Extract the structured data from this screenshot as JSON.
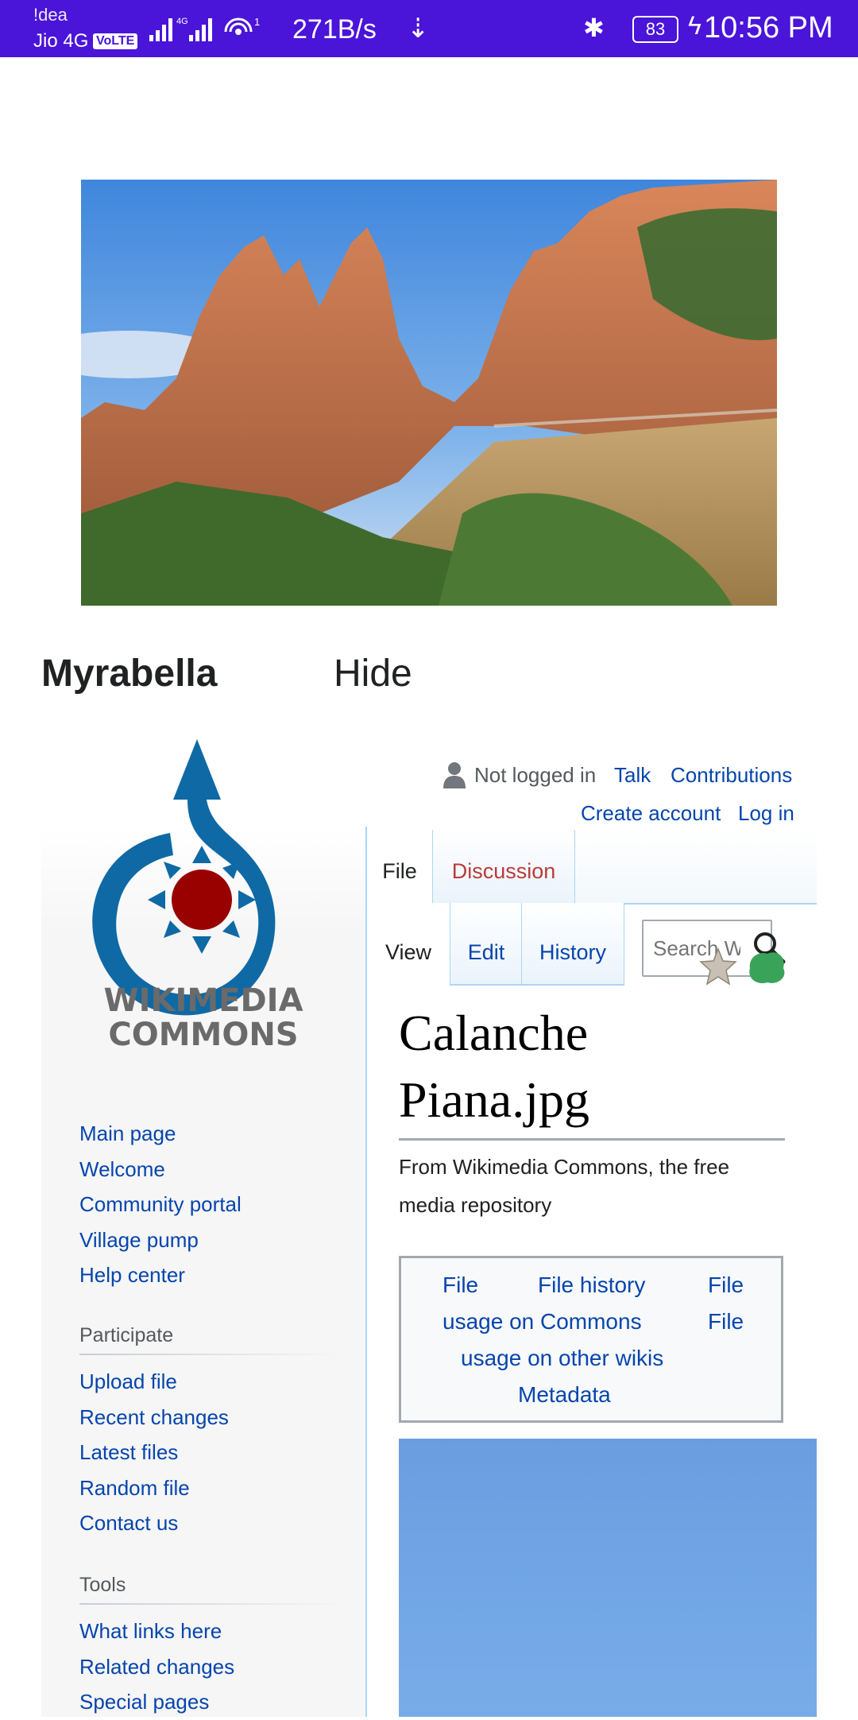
{
  "status_bar": {
    "carrier_1": "!dea",
    "carrier_2": "Jio 4G",
    "volte": "VoLTE",
    "network_speed": "271B/s",
    "battery_level": "83",
    "time": "10:56 PM"
  },
  "author": {
    "name": "Myrabella",
    "hide_label": "Hide"
  },
  "logo": {
    "line1": "WIKIMEDIA",
    "line2": "COMMONS"
  },
  "navigation": [
    "Main page",
    "Welcome",
    "Community portal",
    "Village pump",
    "Help center"
  ],
  "participate": {
    "heading": "Participate",
    "items": [
      "Upload file",
      "Recent changes",
      "Latest files",
      "Random file",
      "Contact us"
    ]
  },
  "tools": {
    "heading": "Tools",
    "items": [
      "What links here",
      "Related changes",
      "Special pages"
    ]
  },
  "personal_tools": {
    "status": "Not logged in",
    "talk": "Talk",
    "contributions": "Contributions",
    "create_account": "Create account",
    "log_in": "Log in"
  },
  "tabs": {
    "file": "File",
    "discussion": "Discussion",
    "view": "View",
    "edit": "Edit",
    "history": "History"
  },
  "search": {
    "placeholder": "Search Wikimedia Commons"
  },
  "page": {
    "title_line1": "Calanche",
    "title_line2": "Piana.jpg",
    "tagline": "From Wikimedia Commons, the free media repository"
  },
  "toc": {
    "file": "File",
    "file_history": "File history",
    "file_usage_commons_a": "File",
    "file_usage_commons_b": "usage on Commons",
    "file_usage_other_a": "File",
    "file_usage_other_b": "usage on other wikis",
    "metadata": "Metadata"
  },
  "colors": {
    "status_bar": "#4a14d9",
    "link": "#0645ad",
    "new_link": "#ba3a3a",
    "tab_border": "#a7d7f9"
  }
}
